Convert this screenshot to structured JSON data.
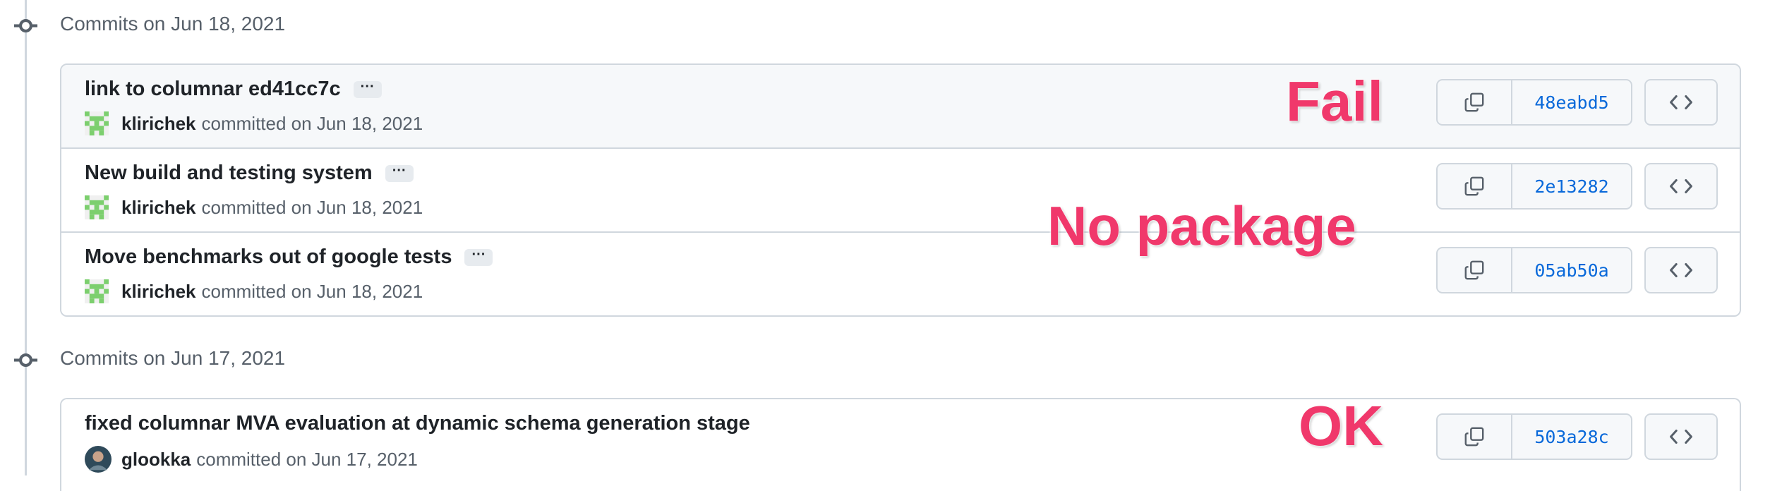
{
  "groups": [
    {
      "title": "Commits on Jun 18, 2021",
      "commits": [
        {
          "message": "link to columnar ed41cc7c",
          "has_ellipsis": true,
          "author": "klirichek",
          "meta": "committed on Jun 18, 2021",
          "sha": "48eabd5",
          "avatar": "identicon-green"
        },
        {
          "message": "New build and testing system",
          "has_ellipsis": true,
          "author": "klirichek",
          "meta": "committed on Jun 18, 2021",
          "sha": "2e13282",
          "avatar": "identicon-green"
        },
        {
          "message": "Move benchmarks out of google tests",
          "has_ellipsis": true,
          "author": "klirichek",
          "meta": "committed on Jun 18, 2021",
          "sha": "05ab50a",
          "avatar": "identicon-green"
        }
      ]
    },
    {
      "title": "Commits on Jun 17, 2021",
      "commits": [
        {
          "message": "fixed columnar MVA evaluation at dynamic schema generation stage",
          "has_ellipsis": false,
          "author": "glookka",
          "meta": "committed on Jun 17, 2021",
          "sha": "503a28c",
          "avatar": "photo-avatar"
        }
      ]
    }
  ],
  "ellipsis_label": "···",
  "annotations": {
    "fail": "Fail",
    "no_package": "No package",
    "ok": "OK"
  },
  "icons": {
    "timeline": "git-commit-icon",
    "copy": "copy-icon",
    "browse": "code-icon"
  },
  "colors": {
    "annotation": "#f0386b",
    "sha_link": "#0969da",
    "border": "#d0d7de",
    "identicon": "#7ccf6e"
  }
}
